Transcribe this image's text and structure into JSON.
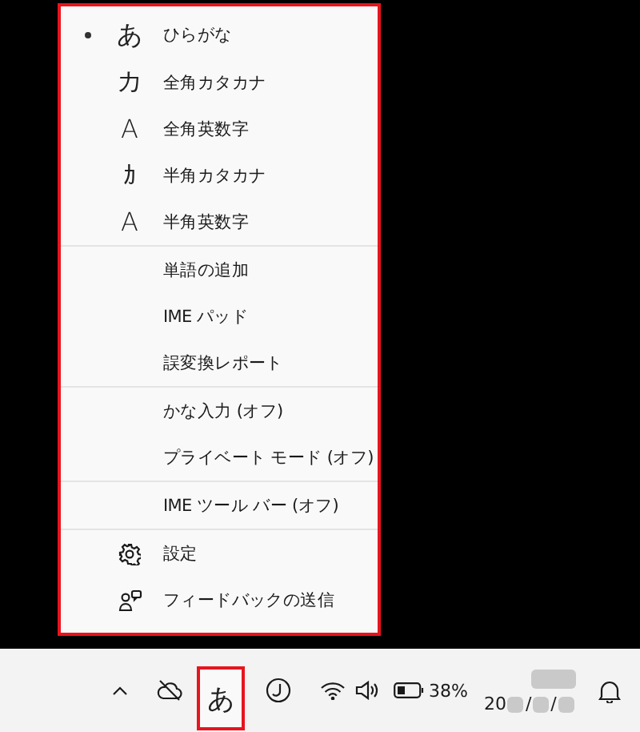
{
  "menu": {
    "highlighted": true,
    "groups": [
      {
        "items": [
          {
            "kind": "mode",
            "glyph": "あ",
            "label": "ひらがな",
            "selected": true
          },
          {
            "kind": "mode",
            "glyph": "カ",
            "label": "全角カタカナ",
            "selected": false
          },
          {
            "kind": "mode",
            "glyph": "A",
            "label": "全角英数字",
            "selected": false
          },
          {
            "kind": "mode",
            "glyph": "ｶ",
            "label": "半角カタカナ",
            "selected": false
          },
          {
            "kind": "mode",
            "glyph": "A",
            "label": "半角英数字",
            "selected": false
          }
        ]
      },
      {
        "items": [
          {
            "kind": "text",
            "label": "単語の追加"
          },
          {
            "kind": "text",
            "label": "IME パッド"
          },
          {
            "kind": "text",
            "label": "誤変換レポート"
          }
        ]
      },
      {
        "items": [
          {
            "kind": "text",
            "label": "かな入力 (オフ)"
          },
          {
            "kind": "text",
            "label": "プライベート モード (オフ)"
          }
        ]
      },
      {
        "items": [
          {
            "kind": "text",
            "label": "IME ツール バー (オフ)"
          }
        ]
      },
      {
        "items": [
          {
            "kind": "settings",
            "label": "設定"
          },
          {
            "kind": "feedback",
            "label": "フィードバックの送信"
          }
        ]
      }
    ]
  },
  "taskbar": {
    "ime_indicator": {
      "text": "あ",
      "highlighted": true
    },
    "battery": "38%",
    "date_fragments": [
      "20",
      "/",
      "/"
    ]
  }
}
